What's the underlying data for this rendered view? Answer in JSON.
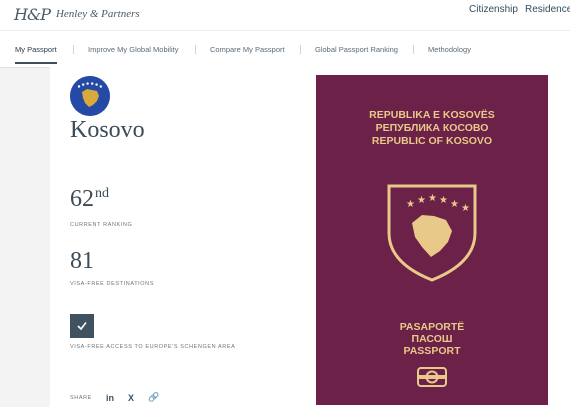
{
  "header": {
    "logo_mark": "H&P",
    "logo_text": "Henley & Partners",
    "links": [
      "Citizenship",
      "Residence"
    ]
  },
  "subnav": {
    "tabs": [
      "My Passport",
      "Improve My Global Mobility",
      "Compare My Passport",
      "Global Passport Ranking",
      "Methodology"
    ],
    "active": "My Passport"
  },
  "profile": {
    "country": "Kosovo",
    "rank_number": "62",
    "rank_suffix": "nd",
    "rank_label": "CURRENT RANKING",
    "destinations": "81",
    "destinations_label": "VISA-FREE DESTINATIONS",
    "schengen_label": "VISA-FREE ACCESS TO EUROPE'S SCHENGEN AREA",
    "share_label": "SHARE",
    "share_icons": [
      "linkedin-icon",
      "x-icon",
      "link-icon"
    ]
  },
  "passport": {
    "line1": "REPUBLIKA E KOSOVËS",
    "line2": "РЕПУБЛИКА КОСОВО",
    "line3": "REPUBLIC OF KOSOVO",
    "word1": "PASAPORTË",
    "word2": "ПАСОШ",
    "word3": "PASSPORT"
  },
  "colors": {
    "passport_cover": "#6b2148",
    "passport_gold": "#e9c98a",
    "flag_blue": "#244aa5",
    "check_box": "#3e5261"
  }
}
